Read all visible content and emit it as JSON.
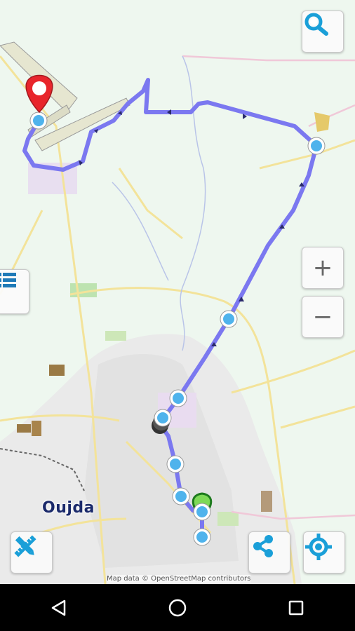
{
  "map": {
    "city_label": "Oujda",
    "attribution": "Map data © OpenStreetMap contributors",
    "route_color": "#7b78f0",
    "marker_color": "#e8252b",
    "waypoint_color": "#4fb3ec"
  },
  "controls": {
    "search": "search-icon",
    "layers": "list-icon",
    "zoom_in": "+",
    "zoom_out": "−",
    "clear": "ruler-pencil-icon",
    "share": "share-icon",
    "my_location": "locate-icon"
  },
  "navbar": {
    "back": "back-icon",
    "home": "home-icon",
    "recents": "recents-icon"
  }
}
